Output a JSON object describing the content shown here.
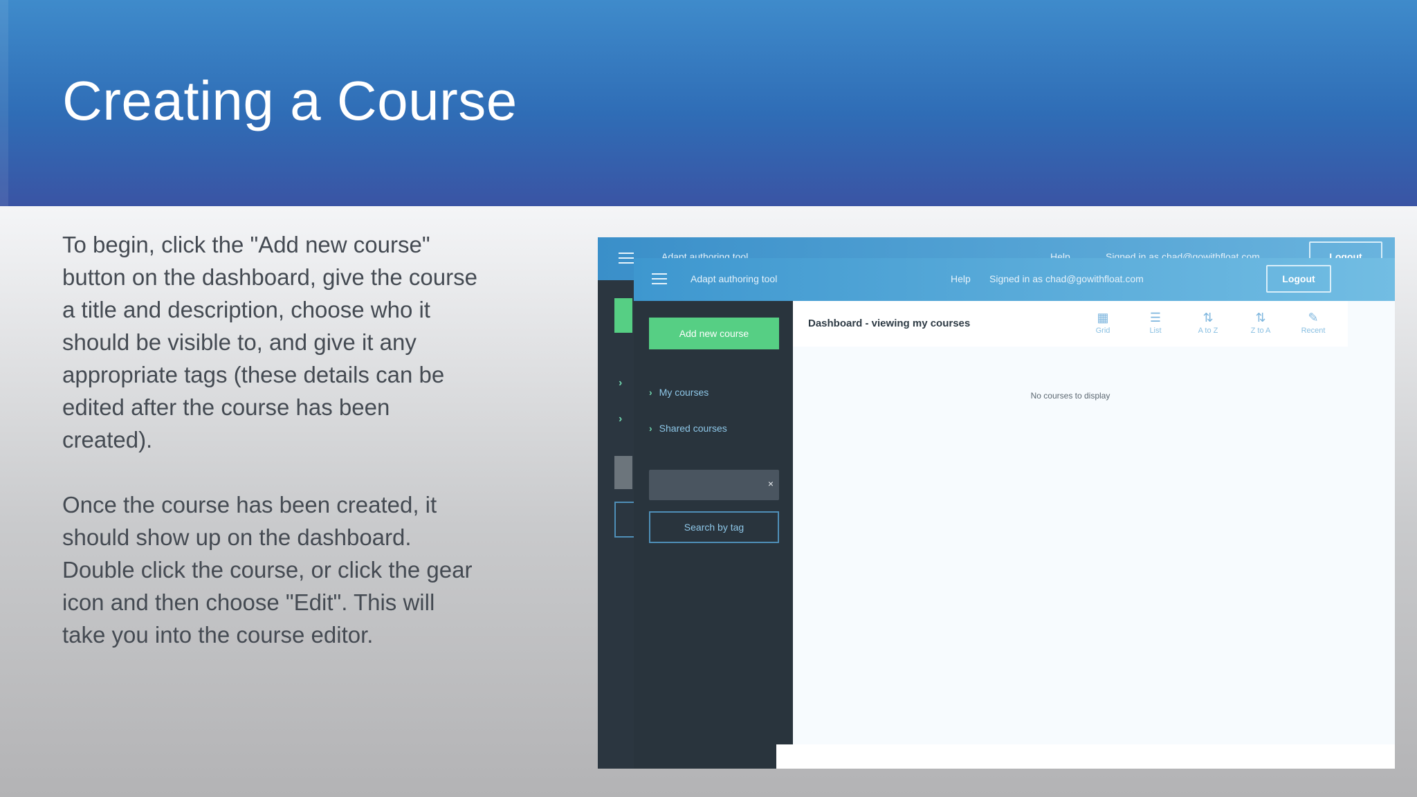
{
  "slide": {
    "title": "Creating a Course",
    "paragraph1": "To begin, click the \"Add new course\" button on the dashboard, give the course a title and description, choose who it should be visible to, and give it any appropriate tags (these details can be edited after the course has been created).",
    "paragraph2": "Once the course has been created, it should show up on the dashboard. Double click the course, or click the gear icon and then choose \"Edit\". This will take you into the course editor."
  },
  "app": {
    "name": "Adapt authoring tool",
    "help": "Help",
    "signed_in": "Signed in as chad@gowithfloat.com",
    "logout": "Logout",
    "add_new_course": "Add new course",
    "my_courses": "My courses",
    "shared_courses": "Shared courses",
    "search_by_tag": "Search by tag",
    "clear_symbol": "×",
    "dashboard_title": "Dashboard - viewing my courses",
    "no_courses": "No courses to display",
    "view_options": [
      {
        "label": "Grid",
        "icon": "grid-icon"
      },
      {
        "label": "List",
        "icon": "list-icon"
      },
      {
        "label": "A to Z",
        "icon": "sort-az-icon"
      },
      {
        "label": "Z to A",
        "icon": "sort-za-icon"
      },
      {
        "label": "Recent",
        "icon": "edit-icon"
      }
    ]
  },
  "colors": {
    "header_blue": "#2f6db6",
    "accent_green": "#56cf84",
    "sidebar_dark": "#29343d"
  }
}
